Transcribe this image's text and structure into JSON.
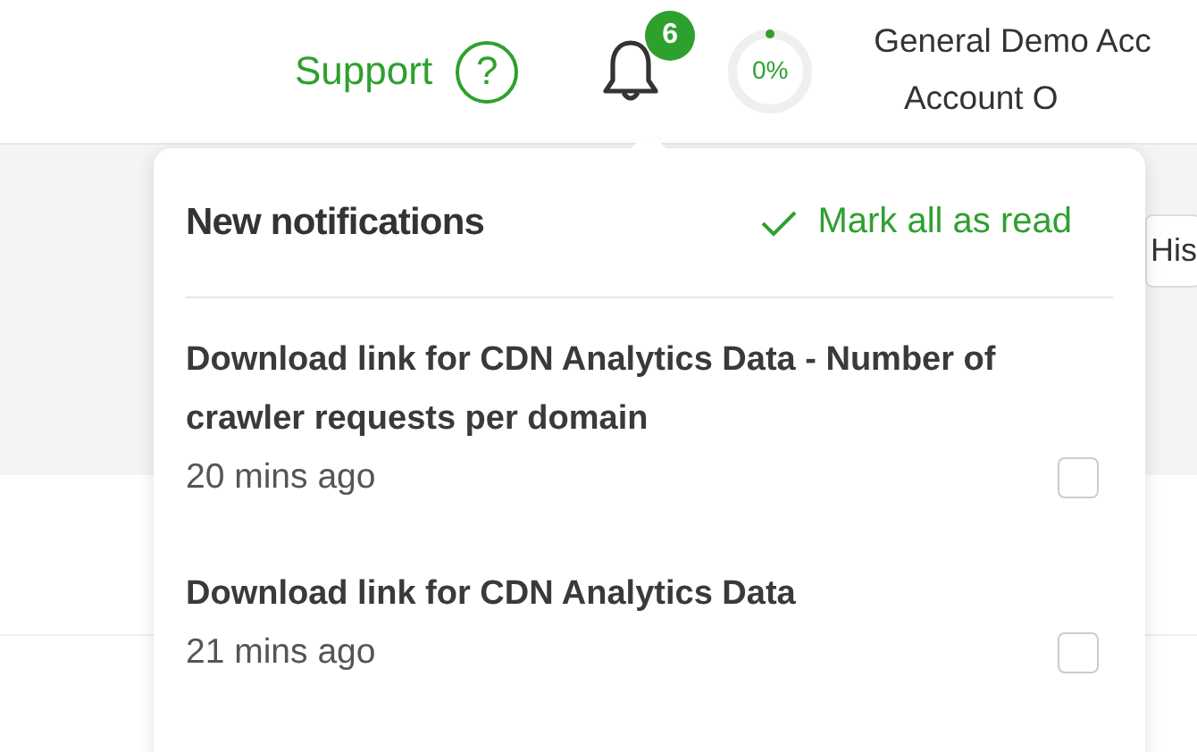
{
  "header": {
    "support": "Support",
    "help_icon": "?",
    "notification_count": "6",
    "progress": {
      "level": 0,
      "reading": "0%"
    },
    "account": {
      "name": "General Demo Acc",
      "subtitle": "Account O"
    }
  },
  "background": {
    "button": "His"
  },
  "notifications": {
    "title": "New notifications",
    "mark_all": "Mark all as read",
    "items": [
      {
        "title": "Download link for CDN Analytics Data - Number of crawler requests per domain",
        "time": "20 mins ago",
        "checked": false
      },
      {
        "title": "Download link for CDN Analytics Data",
        "time": "21 mins ago",
        "checked": false
      }
    ]
  }
}
